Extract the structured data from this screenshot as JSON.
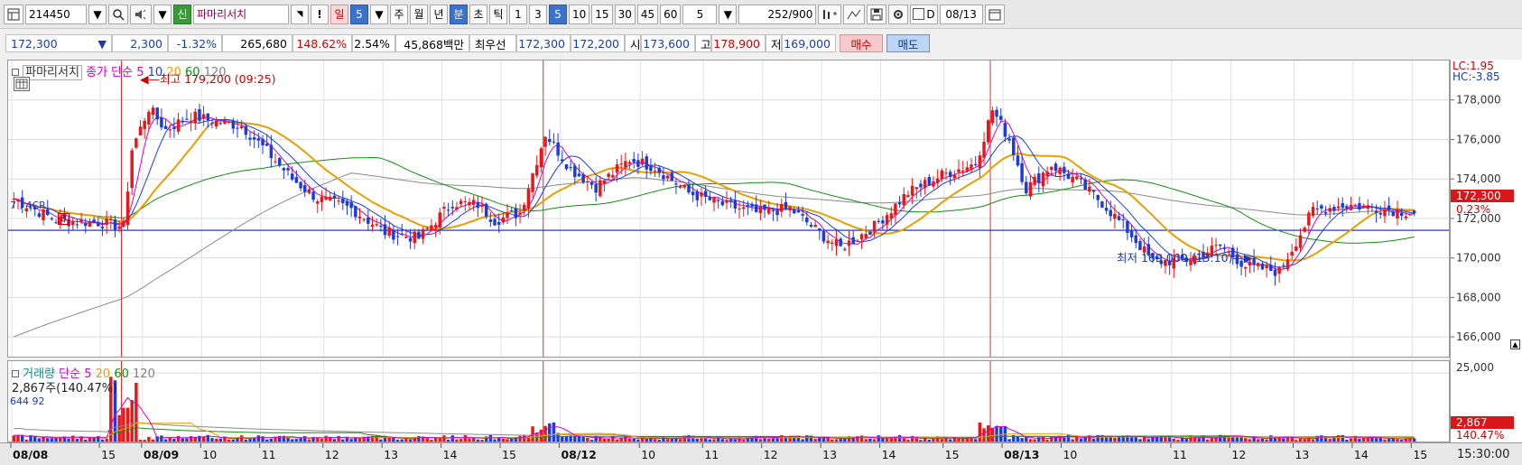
{
  "toolbar": {
    "stock_code": "214450",
    "stock_name": "파마리서치",
    "new_badge": "신",
    "alert_label": "!",
    "period_day": "일",
    "period_day_value": "5",
    "period_week": "주",
    "period_month": "월",
    "period_year": "년",
    "period_minute": "분",
    "period_second": "초",
    "period_tick": "틱",
    "intervals": [
      "1",
      "3",
      "5",
      "10",
      "15",
      "30",
      "45",
      "60"
    ],
    "selected_interval": "5",
    "count_value": "5",
    "bar_count": "252",
    "bar_total": "/900",
    "d_label": "D",
    "date_value": "08/13"
  },
  "info": {
    "price": "172,300",
    "change_arrow": "▼",
    "change": "2,300",
    "change_pct": "-1.32%",
    "volume": "265,680",
    "volume_ratio": "148.62%",
    "turnover_pct": "2.54%",
    "amount": "45,868백만",
    "best_label": "최우선",
    "best_ask": "172,300",
    "best_bid": "172,200",
    "open_label": "시",
    "open": "173,600",
    "high_label": "고",
    "high": "178,900",
    "low_label": "저",
    "low": "169,000",
    "buy_button": "매수",
    "sell_button": "매도"
  },
  "price_panel": {
    "title": "파마리서치",
    "legend_label": "종가 단순",
    "ma_periods": [
      "5",
      "10",
      "20",
      "60",
      "120"
    ],
    "ma_colors": [
      "#d000d0",
      "#1a3cdc",
      "#e8a000",
      "#109010",
      "#808080"
    ],
    "high_note": "최고 179,200 (09:25)",
    "low_note": "최저 169,000 (13:10)",
    "left_marker": "7 , 4CR",
    "b_marker": "B",
    "lc_label": "LC:1.95",
    "hc_label": "HC:-3.85",
    "current_price_tag": "172,300",
    "current_pct_tag": "0.23%"
  },
  "volume_panel": {
    "title": "거래량",
    "legend_label": "단순",
    "ma_periods": [
      "5",
      "20",
      "60",
      "120"
    ],
    "current_volume": "2,867주(140.47%)",
    "left_marker": "644 92",
    "current_tag": "2,867",
    "current_pct_tag": "140.47%",
    "axis_label": "25,000"
  },
  "x_axis": {
    "labels": [
      "08/08",
      "15",
      "08/09",
      "10",
      "11",
      "12",
      "13",
      "14",
      "15",
      "08/12",
      "10",
      "11",
      "12",
      "13",
      "14",
      "15",
      "08/13",
      "10",
      "11",
      "12",
      "13",
      "14",
      "15"
    ],
    "time_label": "15:30:00"
  },
  "chart_data": {
    "type": "candlestick",
    "y_ticks": [
      166000,
      168000,
      170000,
      172000,
      174000,
      176000,
      178000
    ],
    "ylim": [
      165000,
      180000
    ],
    "reference_line": 171400,
    "day_separators": [
      "08/09",
      "08/12",
      "08/13"
    ],
    "close_anchors": [
      [
        0,
        173000
      ],
      [
        10,
        171900
      ],
      [
        20,
        171800
      ],
      [
        26,
        171600
      ],
      [
        28,
        175500
      ],
      [
        32,
        177600
      ],
      [
        36,
        176500
      ],
      [
        42,
        177200
      ],
      [
        48,
        176900
      ],
      [
        54,
        176700
      ],
      [
        60,
        175400
      ],
      [
        66,
        174000
      ],
      [
        72,
        173000
      ],
      [
        80,
        172500
      ],
      [
        88,
        171300
      ],
      [
        96,
        171000
      ],
      [
        104,
        172800
      ],
      [
        110,
        172700
      ],
      [
        114,
        171900
      ],
      [
        120,
        172300
      ],
      [
        126,
        176300
      ],
      [
        132,
        174500
      ],
      [
        138,
        173600
      ],
      [
        146,
        175000
      ],
      [
        152,
        174600
      ],
      [
        160,
        173300
      ],
      [
        168,
        172700
      ],
      [
        176,
        172300
      ],
      [
        184,
        172500
      ],
      [
        192,
        171100
      ],
      [
        196,
        170500
      ],
      [
        204,
        171600
      ],
      [
        212,
        173300
      ],
      [
        220,
        174200
      ],
      [
        228,
        174800
      ],
      [
        232,
        177500
      ],
      [
        236,
        176000
      ],
      [
        240,
        173500
      ],
      [
        246,
        174700
      ],
      [
        252,
        173900
      ],
      [
        258,
        172800
      ],
      [
        264,
        171400
      ],
      [
        270,
        169800
      ],
      [
        278,
        169900
      ],
      [
        286,
        170600
      ],
      [
        292,
        169600
      ],
      [
        300,
        169300
      ],
      [
        308,
        172400
      ],
      [
        316,
        172700
      ],
      [
        324,
        172500
      ],
      [
        332,
        172300
      ]
    ],
    "volume_ylim": [
      0,
      28000
    ]
  }
}
